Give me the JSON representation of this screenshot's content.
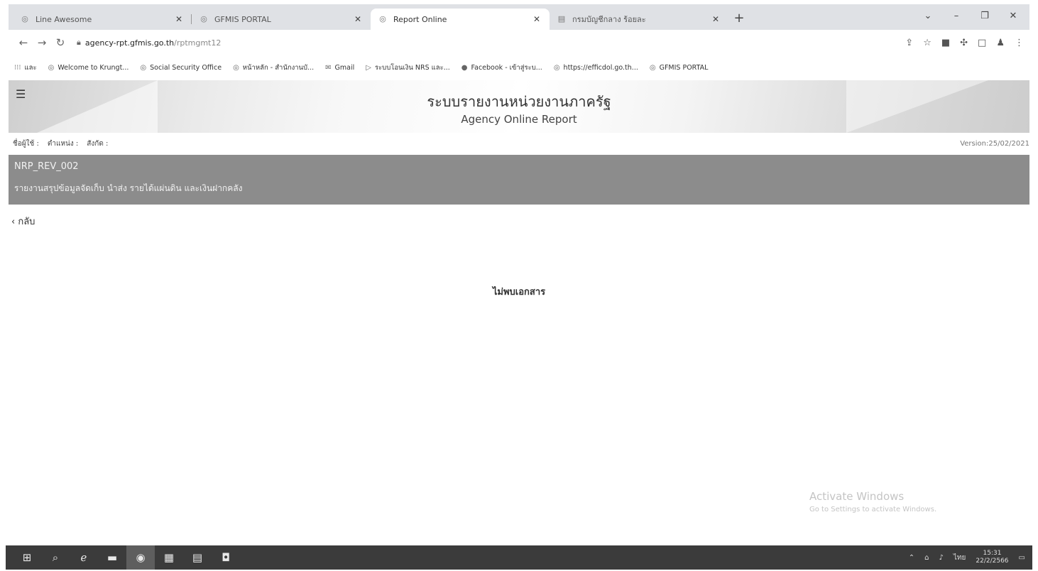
{
  "browser": {
    "tabs": [
      {
        "title": "Line Awesome",
        "icon": "globe-icon",
        "active": false
      },
      {
        "title": "GFMIS PORTAL",
        "icon": "globe-icon",
        "active": false
      },
      {
        "title": "Report Online",
        "icon": "globe-icon",
        "active": true
      },
      {
        "title": "กรมบัญชีกลาง ร้อยละ",
        "icon": "doc-icon",
        "active": false
      }
    ],
    "new_tab_label": "+",
    "address": {
      "host": "agency-rpt.gfmis.go.th",
      "path": "/rptmgmt12"
    },
    "bookmarks": [
      {
        "label": "และ",
        "icon": "apps-icon"
      },
      {
        "label": "Welcome to Krungt...",
        "icon": "globe-icon"
      },
      {
        "label": "Social Security Office",
        "icon": "globe-icon"
      },
      {
        "label": "หน้าหลัก - สำนักงานบั...",
        "icon": "globe-icon"
      },
      {
        "label": "Gmail",
        "icon": "mail-icon"
      },
      {
        "label": "ระบบโอนเงิน NRS และ...",
        "icon": "play-icon"
      },
      {
        "label": "Facebook - เข้าสู่ระบ...",
        "icon": "facebook-icon"
      },
      {
        "label": "https://efficdol.go.th...",
        "icon": "globe-icon"
      },
      {
        "label": "GFMIS PORTAL",
        "icon": "globe-icon"
      }
    ]
  },
  "header": {
    "title_th": "ระบบรายงานหน่วยงานภาครัฐ",
    "title_en": "Agency Online Report"
  },
  "user": {
    "username_label": "ชื่อผู้ใช้ :",
    "position_label": "ตำแหน่ง :",
    "org_label": "สังกัด :",
    "version": "Version:25/02/2021"
  },
  "report": {
    "code": "NRP_REV_002",
    "name": "รายงานสรุปข้อมูลจัดเก็บ นำส่ง รายได้แผ่นดิน และเงินฝากคลัง"
  },
  "back_label": "กลับ",
  "no_documents": "ไม่พบเอกสาร",
  "watermark": {
    "line1": "Activate Windows",
    "line2": "Go to Settings to activate Windows."
  },
  "taskbar": {
    "tray_lang": "ไทย",
    "time": "15:31",
    "date": "22/2/2566"
  }
}
